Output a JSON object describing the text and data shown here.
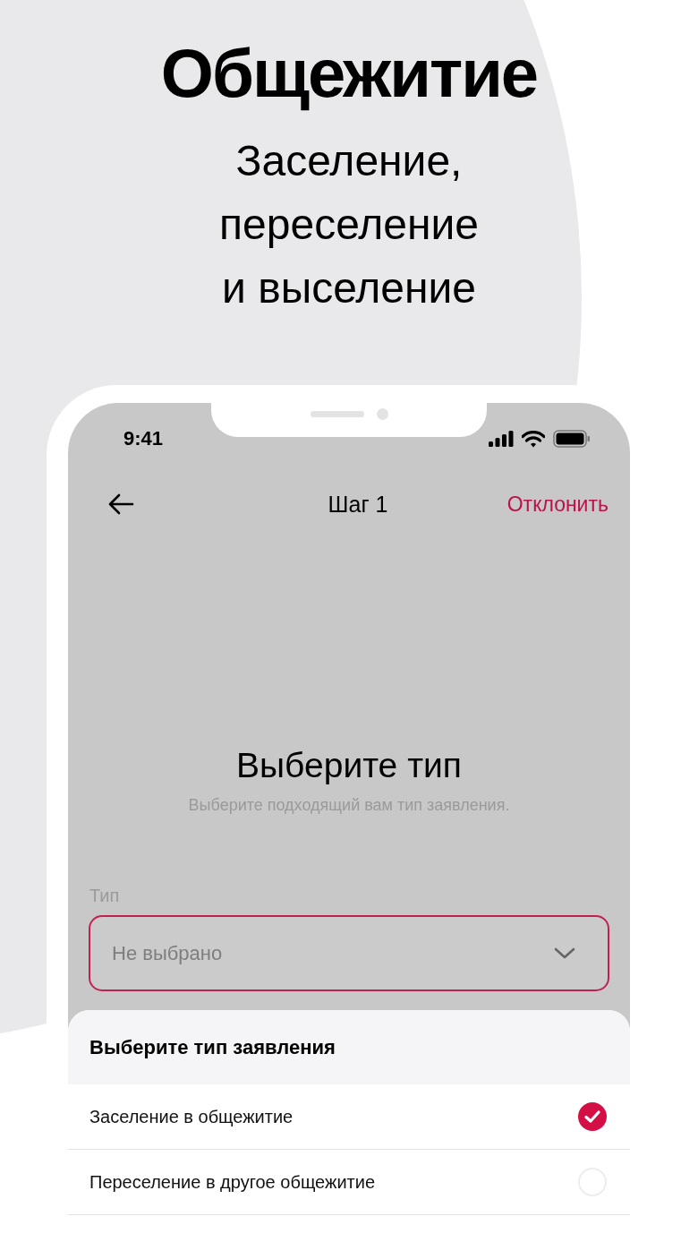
{
  "promo": {
    "title": "Общежитие",
    "subtitle": [
      "Заселение,",
      "переселение",
      "и выселение"
    ]
  },
  "status_bar": {
    "time": "9:41"
  },
  "nav": {
    "title": "Шаг 1",
    "action": "Отклонить"
  },
  "step": {
    "heading": "Выберите тип",
    "description": "Выберите подходящий вам тип заявления."
  },
  "field": {
    "label": "Тип",
    "placeholder": "Не выбрано"
  },
  "sheet": {
    "title": "Выберите тип заявления",
    "options": [
      {
        "label": "Заселение в общежитие",
        "selected": true
      },
      {
        "label": "Переселение в другое общежитие",
        "selected": false
      }
    ]
  }
}
